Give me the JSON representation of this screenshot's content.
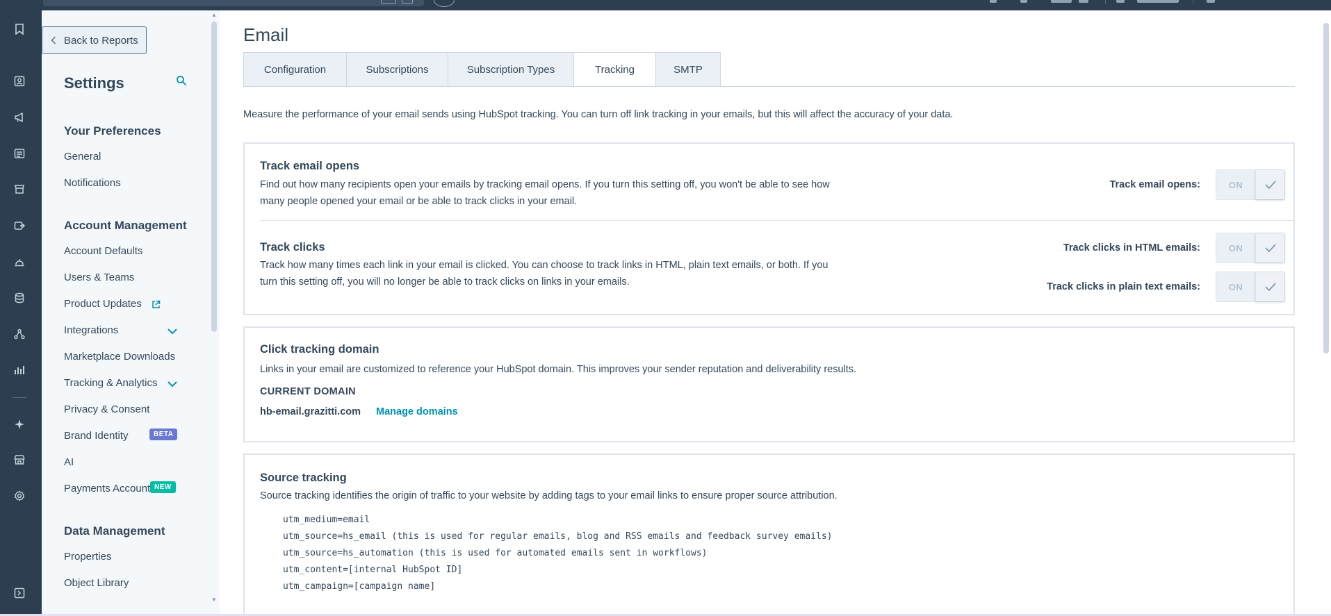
{
  "sidebar": {
    "back_label": "Back to Reports",
    "title": "Settings",
    "sections": [
      {
        "heading": "Your Preferences",
        "items": [
          {
            "label": "General"
          },
          {
            "label": "Notifications"
          }
        ]
      },
      {
        "heading": "Account Management",
        "items": [
          {
            "label": "Account Defaults"
          },
          {
            "label": "Users & Teams"
          },
          {
            "label": "Product Updates"
          },
          {
            "label": "Integrations"
          },
          {
            "label": "Marketplace Downloads"
          },
          {
            "label": "Tracking & Analytics"
          },
          {
            "label": "Privacy & Consent"
          },
          {
            "label": "Brand Identity",
            "badge": "BETA"
          },
          {
            "label": "AI"
          },
          {
            "label": "Payments Account",
            "badge": "NEW"
          }
        ]
      },
      {
        "heading": "Data Management",
        "items": [
          {
            "label": "Properties"
          },
          {
            "label": "Object Library"
          }
        ]
      }
    ]
  },
  "main": {
    "title": "Email",
    "tabs": [
      {
        "label": "Configuration",
        "active": false
      },
      {
        "label": "Subscriptions",
        "active": false
      },
      {
        "label": "Subscription Types",
        "active": false
      },
      {
        "label": "Tracking",
        "active": true
      },
      {
        "label": "SMTP",
        "active": false
      }
    ],
    "intro": "Measure the performance of your email sends using HubSpot tracking. You can turn off link tracking in your emails, but this will affect the accuracy of your data.",
    "tracking_card": {
      "opens_title": "Track email opens",
      "opens_desc_1": "Find out how many recipients open your emails by tracking email opens. If you turn this setting off, you won't be able to see how",
      "opens_desc_2": "many people opened your email or be able to track clicks in your email.",
      "opens_toggle_label": "Track email opens:",
      "clicks_title": "Track clicks",
      "clicks_desc_1": "Track how many times each link in your email is clicked. You can choose to track links in HTML, plain text emails, or both. If you",
      "clicks_desc_2": "turn this setting off, you will no longer be able to track clicks on links in your emails.",
      "clicks_html_label": "Track clicks in HTML emails:",
      "clicks_plain_label": "Track clicks in plain text emails:",
      "toggle_state": "ON"
    },
    "domain_card": {
      "title": "Click tracking domain",
      "desc": "Links in your email are customized to reference your HubSpot domain. This improves your sender reputation and deliverability results.",
      "current_label": "CURRENT DOMAIN",
      "domain": "hb-email.grazitti.com",
      "manage_label": "Manage domains"
    },
    "source_card": {
      "title": "Source tracking",
      "desc": "Source tracking identifies the origin of traffic to your website by adding tags to your email links to ensure proper source attribution.",
      "params": [
        "utm_medium=email",
        "utm_source=hs_email (this is used for regular emails, blog and RSS emails and feedback survey emails)",
        "utm_source=hs_automation (this is used for automated emails sent in workflows)",
        "utm_content=[internal HubSpot ID]",
        "utm_campaign=[campaign name]"
      ]
    }
  },
  "colors": {
    "nav_dark": "#2d3e50",
    "sidebar_bg": "#f5f8fa",
    "text": "#33475b",
    "link": "#0091ae",
    "beta_badge": "#6a78d1",
    "new_badge": "#00bda5"
  },
  "icons": [
    "bookmark-icon",
    "contacts-icon",
    "megaphone-icon",
    "content-icon",
    "commerce-icon",
    "automation-icon",
    "service-icon",
    "data-icon",
    "workflow-icon",
    "reports-icon",
    "sparkle-icon",
    "store-icon",
    "settings-icon",
    "expand-icon"
  ]
}
